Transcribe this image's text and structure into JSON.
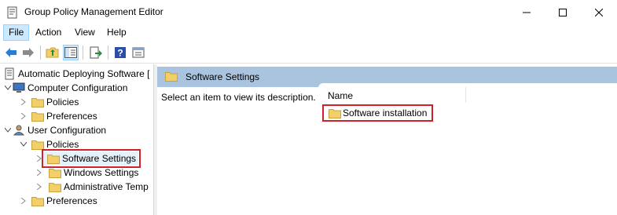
{
  "window": {
    "title": "Group Policy Management Editor"
  },
  "menu": {
    "file": "File",
    "action": "Action",
    "view": "View",
    "help": "Help"
  },
  "colors": {
    "selection_outline": "#d0202a",
    "header_band": "#aac4e0",
    "folder": "#f3cf6a"
  },
  "tree": {
    "root": "Automatic Deploying Software [",
    "computer_config": "Computer Configuration",
    "cc_policies": "Policies",
    "cc_preferences": "Preferences",
    "user_config": "User Configuration",
    "uc_policies": "Policies",
    "software_settings": "Software Settings",
    "windows_settings": "Windows Settings",
    "admin_templates": "Administrative Temp",
    "uc_preferences": "Preferences"
  },
  "right_pane": {
    "header_title": "Software Settings",
    "description": "Select an item to view its description.",
    "column_name": "Name",
    "items": [
      "Software installation"
    ]
  }
}
